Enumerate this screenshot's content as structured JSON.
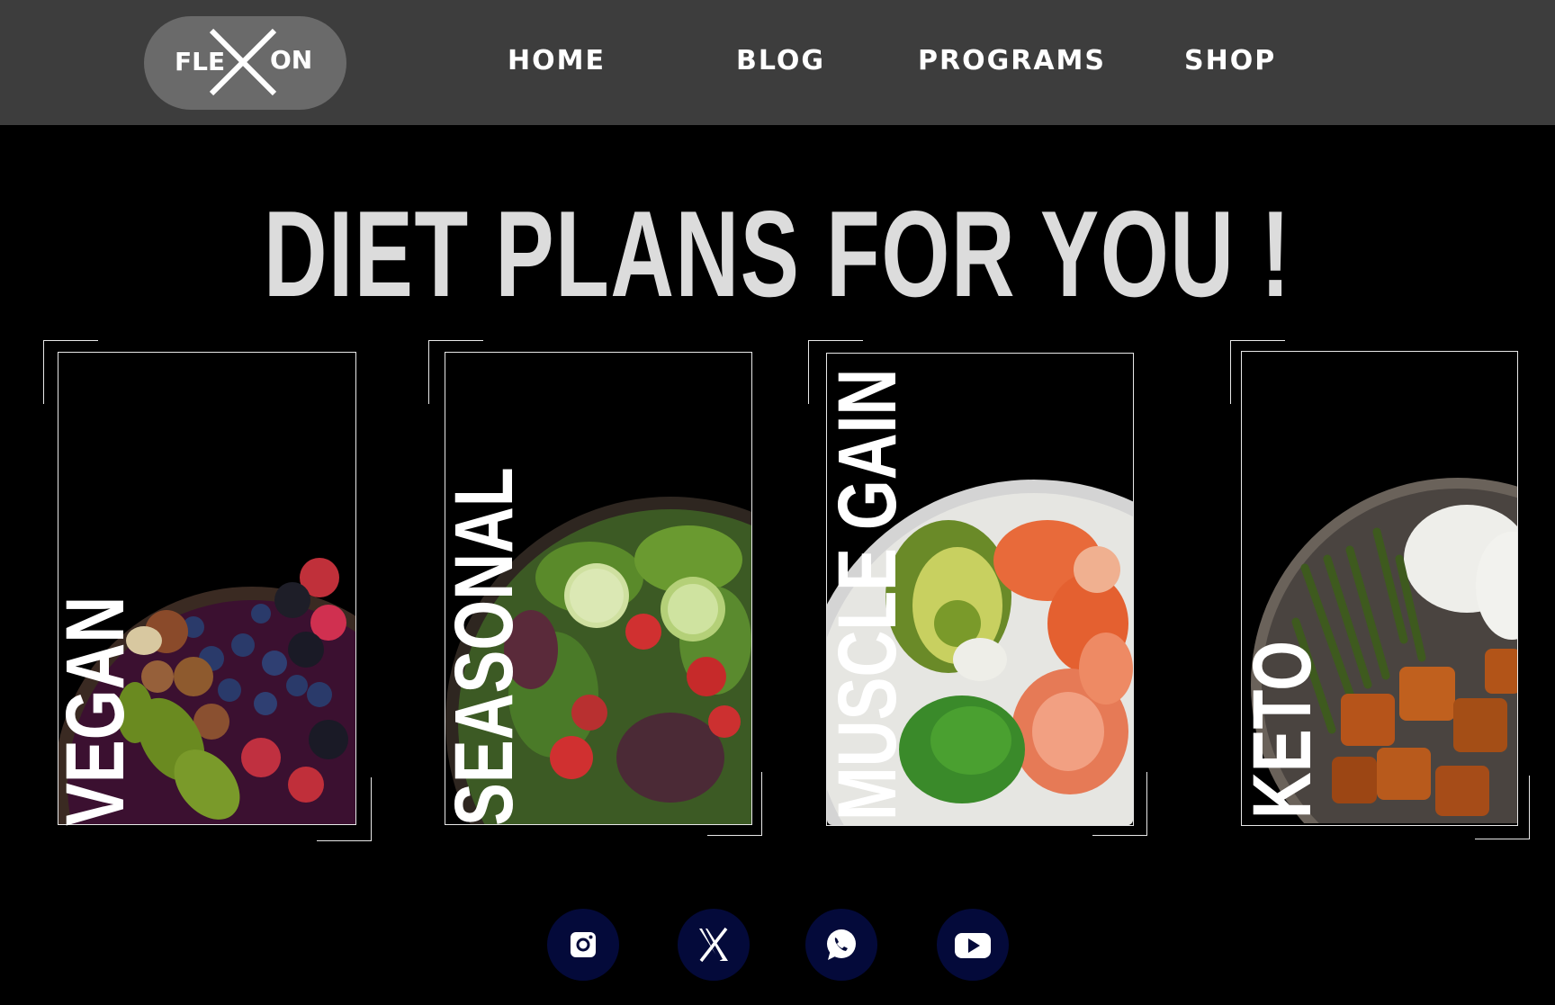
{
  "navbar": {
    "logo_left": "FLE",
    "logo_right": "ON",
    "links": [
      "HOME",
      "BLOG",
      "PROGRAMS",
      "SHOP"
    ]
  },
  "headline": "DIET PLANS FOR YOU !",
  "cards": [
    {
      "label": "VEGAN",
      "image": "acai-berry-bowl"
    },
    {
      "label": "SEASONAL",
      "image": "green-salad-bowl"
    },
    {
      "label": "MUSCLE GAIN",
      "image": "shrimp-avocado-poke-bowl"
    },
    {
      "label": "KETO",
      "image": "tofu-green-beans-rice-bowl"
    }
  ],
  "social": [
    "instagram-icon",
    "x-icon",
    "whatsapp-icon",
    "youtube-icon"
  ],
  "colors": {
    "navbar_bg": "#3d3d3d",
    "logo_pill_bg": "#6a6a6a",
    "headline": "#dcdcdc",
    "social_bg": "#040a3a",
    "page_bg": "#000000"
  }
}
